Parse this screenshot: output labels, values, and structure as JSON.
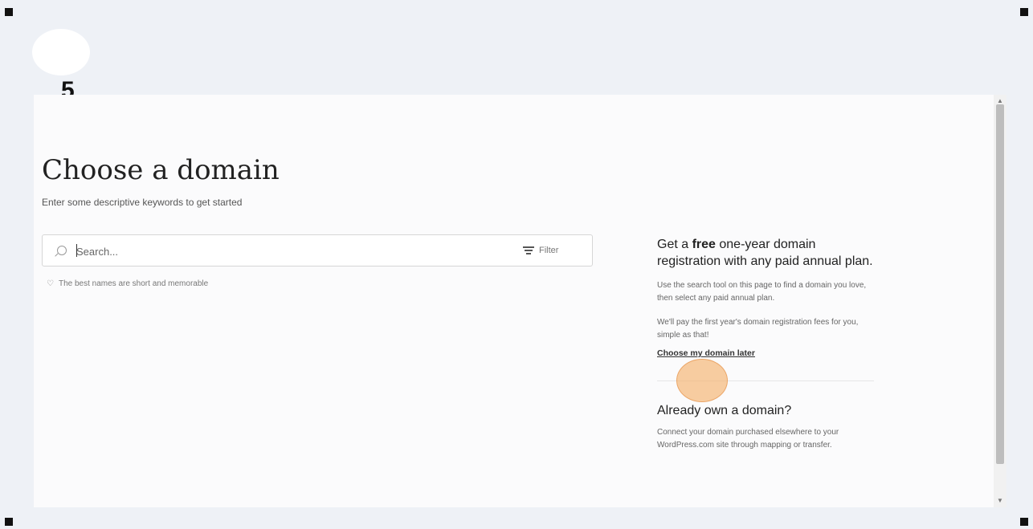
{
  "overlay": {
    "step_number": "5"
  },
  "page": {
    "title": "Choose a domain",
    "subtitle": "Enter some descriptive keywords to get started"
  },
  "search": {
    "placeholder": "Search...",
    "value": "",
    "filter_label": "Filter",
    "icon": "search-icon"
  },
  "tip": {
    "icon": "lightbulb-icon",
    "text": "The best names are short and memorable"
  },
  "sidebar": {
    "promo_heading_pre": "Get a ",
    "promo_heading_bold": "free",
    "promo_heading_post": " one-year domain registration with any paid annual plan.",
    "promo_text_1": "Use the search tool on this page to find a domain you love, then select any paid annual plan.",
    "promo_text_2": "We'll pay the first year's domain registration fees for you, simple as that!",
    "choose_later_link": "Choose my domain later",
    "own_domain_heading": "Already own a domain?",
    "own_domain_text": "Connect your domain purchased elsewhere to your WordPress.com site through mapping or transfer."
  },
  "colors": {
    "background": "#eef1f6",
    "panel": "#fbfbfc",
    "click_highlight": "#f5b26e"
  }
}
